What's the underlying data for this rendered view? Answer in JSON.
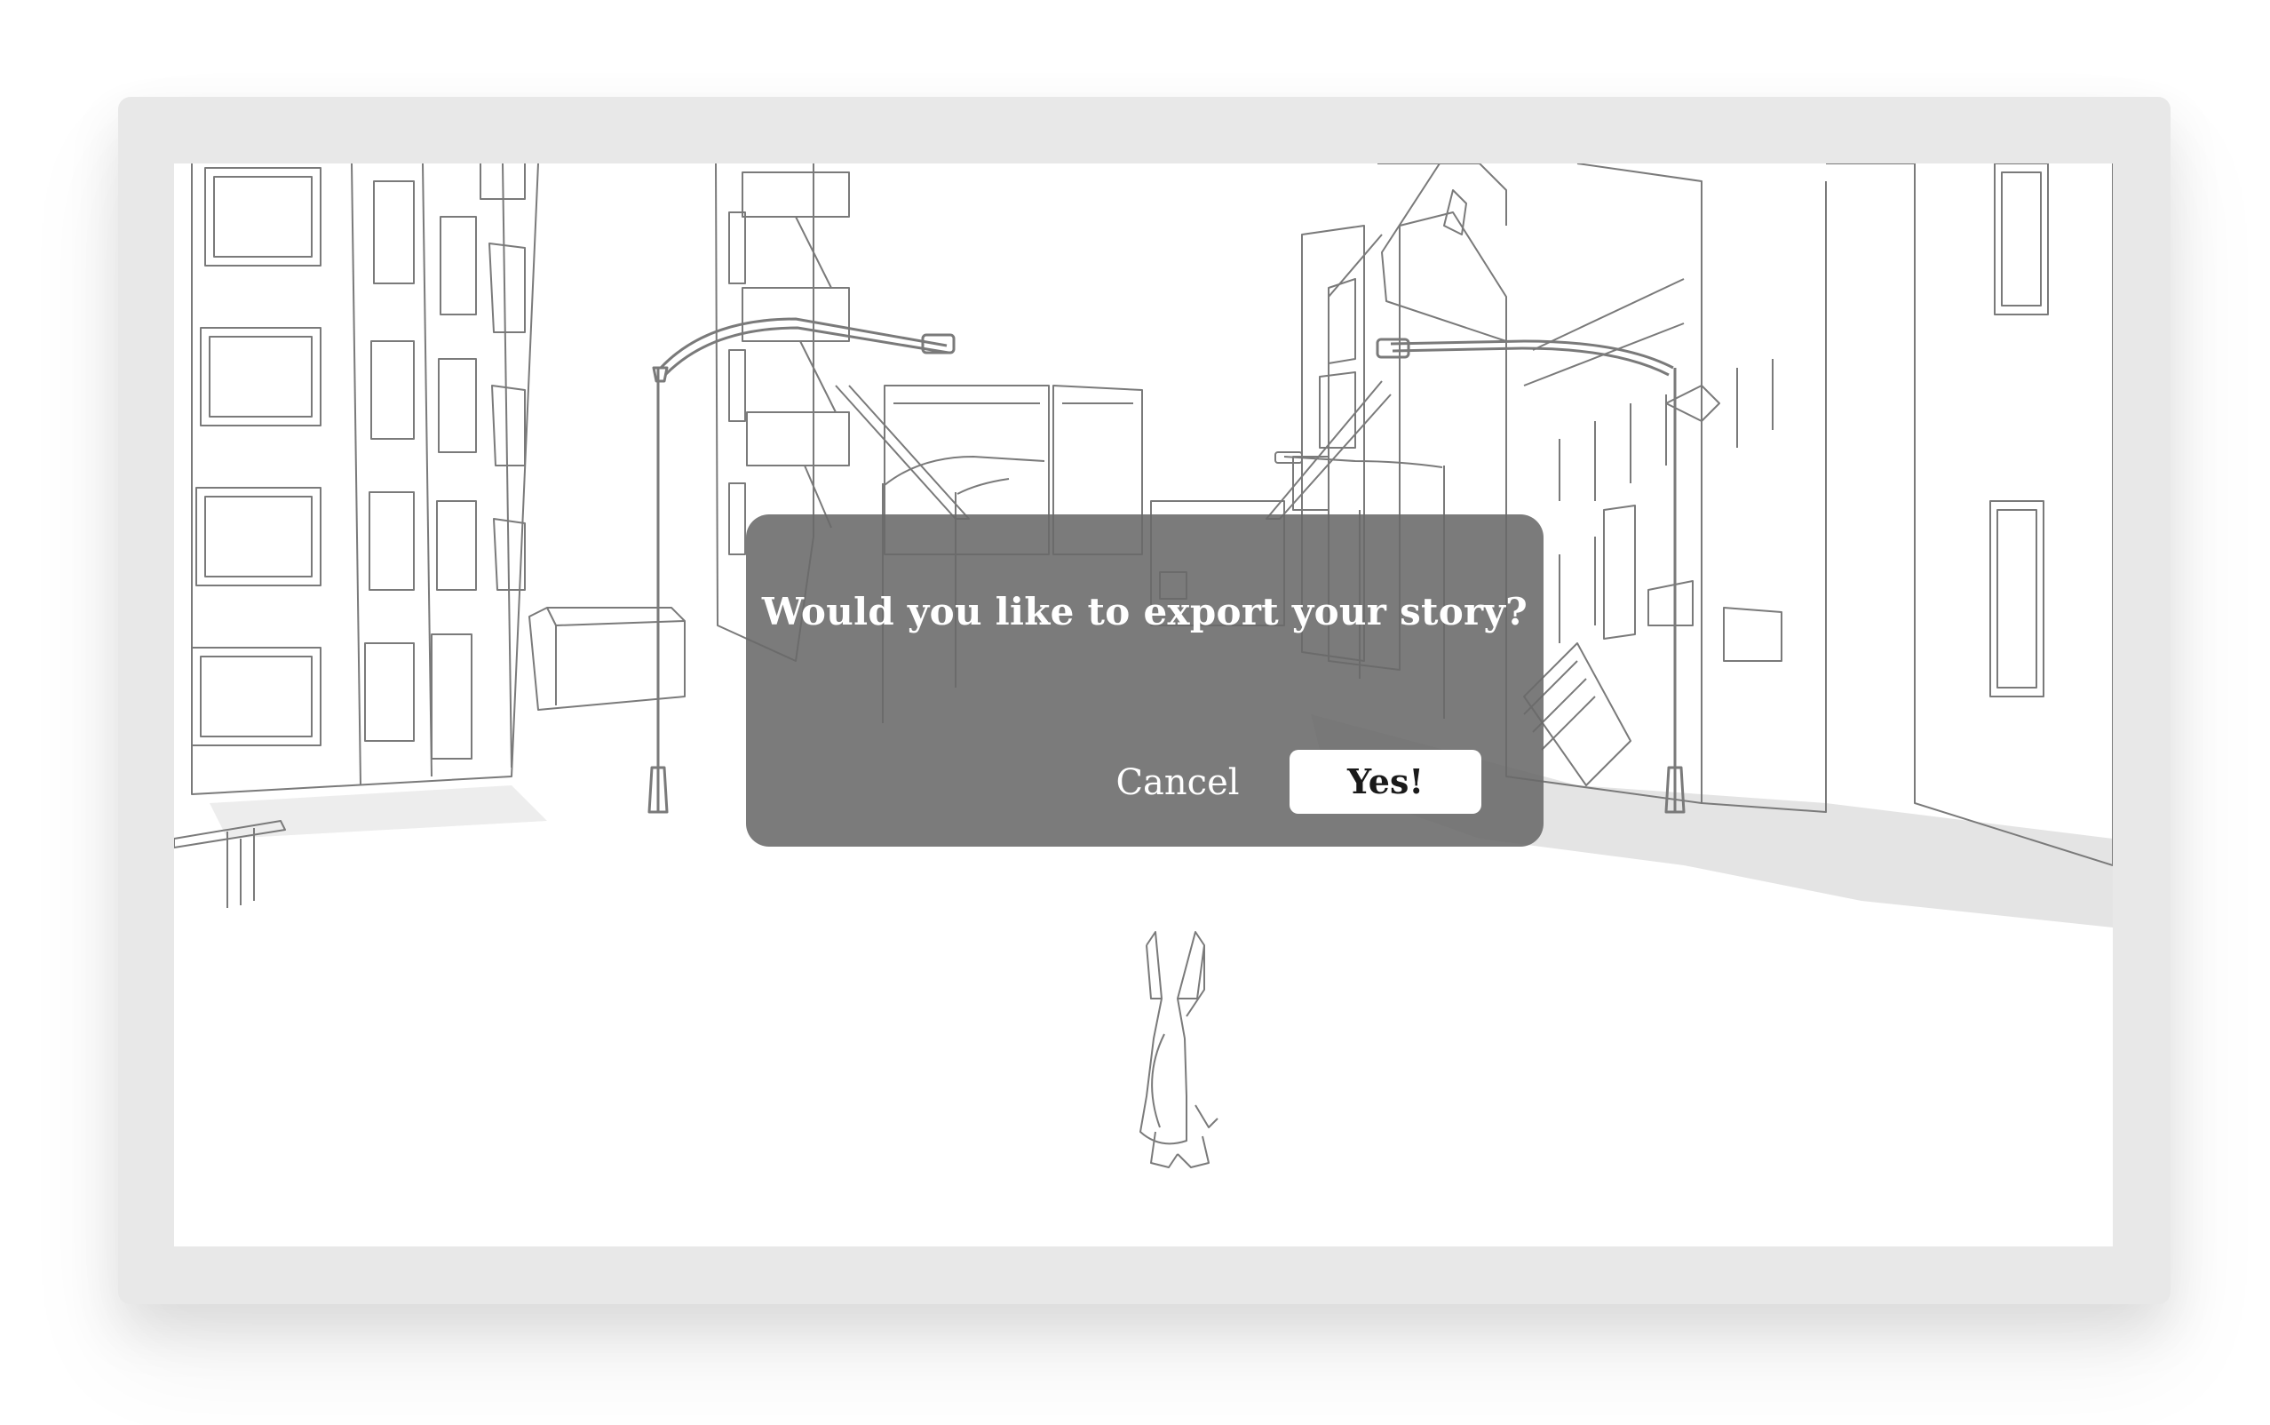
{
  "dialog": {
    "message": "Would you like to export your story?",
    "cancel_label": "Cancel",
    "confirm_label": "Yes!"
  },
  "colors": {
    "frame": "#e8e8e8",
    "dialog_background": "#696969",
    "line_art": "#7a7a7a",
    "shadow": "#e2e2e2"
  }
}
